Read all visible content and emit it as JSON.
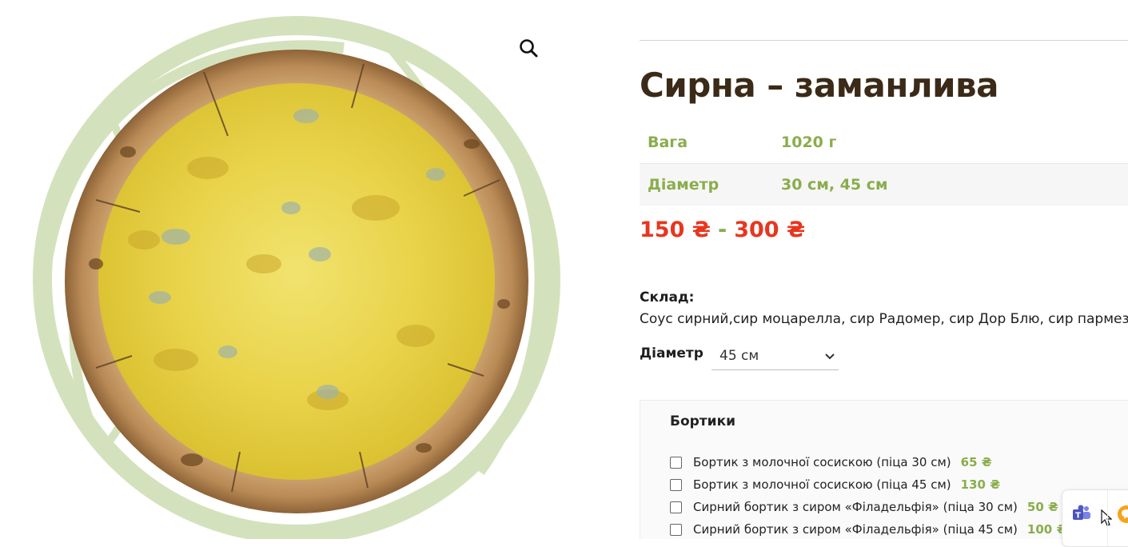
{
  "product": {
    "title": "Сирна – заманлива",
    "image_alt": "pizza-photo"
  },
  "attributes": [
    {
      "label": "Вага",
      "value": "1020 г"
    },
    {
      "label": "Діаметр",
      "value": "30 см, 45 см"
    }
  ],
  "price": {
    "min": "150 ₴",
    "separator": "-",
    "max": "300 ₴"
  },
  "composition": {
    "label": "Склад:",
    "text": "Соус сирний,сир моцарелла, сир Радомер, сир Дор Блю, сир пармезан"
  },
  "variation": {
    "label": "Діаметр",
    "selected": "45 см"
  },
  "addons": {
    "title": "Бортики",
    "options": [
      {
        "label": "Бортик з молочної сосискою (піца 30 см)",
        "price": "65 ₴"
      },
      {
        "label": "Бортик з молочної сосискою (піца 45 см)",
        "price": "130 ₴"
      },
      {
        "label": "Сирний бортик з сиром «Філадельфія» (піца 30 см)",
        "price": "50 ₴"
      },
      {
        "label": "Сирний бортик з сиром «Філадельфія» (піца 45 см)",
        "price": "100 ₴"
      }
    ]
  },
  "colors": {
    "title": "#3b2a17",
    "accent_green": "#8aad4c",
    "price_red": "#e8361e",
    "ring_green": "#d3e2bc"
  },
  "icons": [
    "search-icon",
    "chevron-down-icon",
    "teams-icon",
    "cursor-icon",
    "chat-bubble-icon"
  ]
}
